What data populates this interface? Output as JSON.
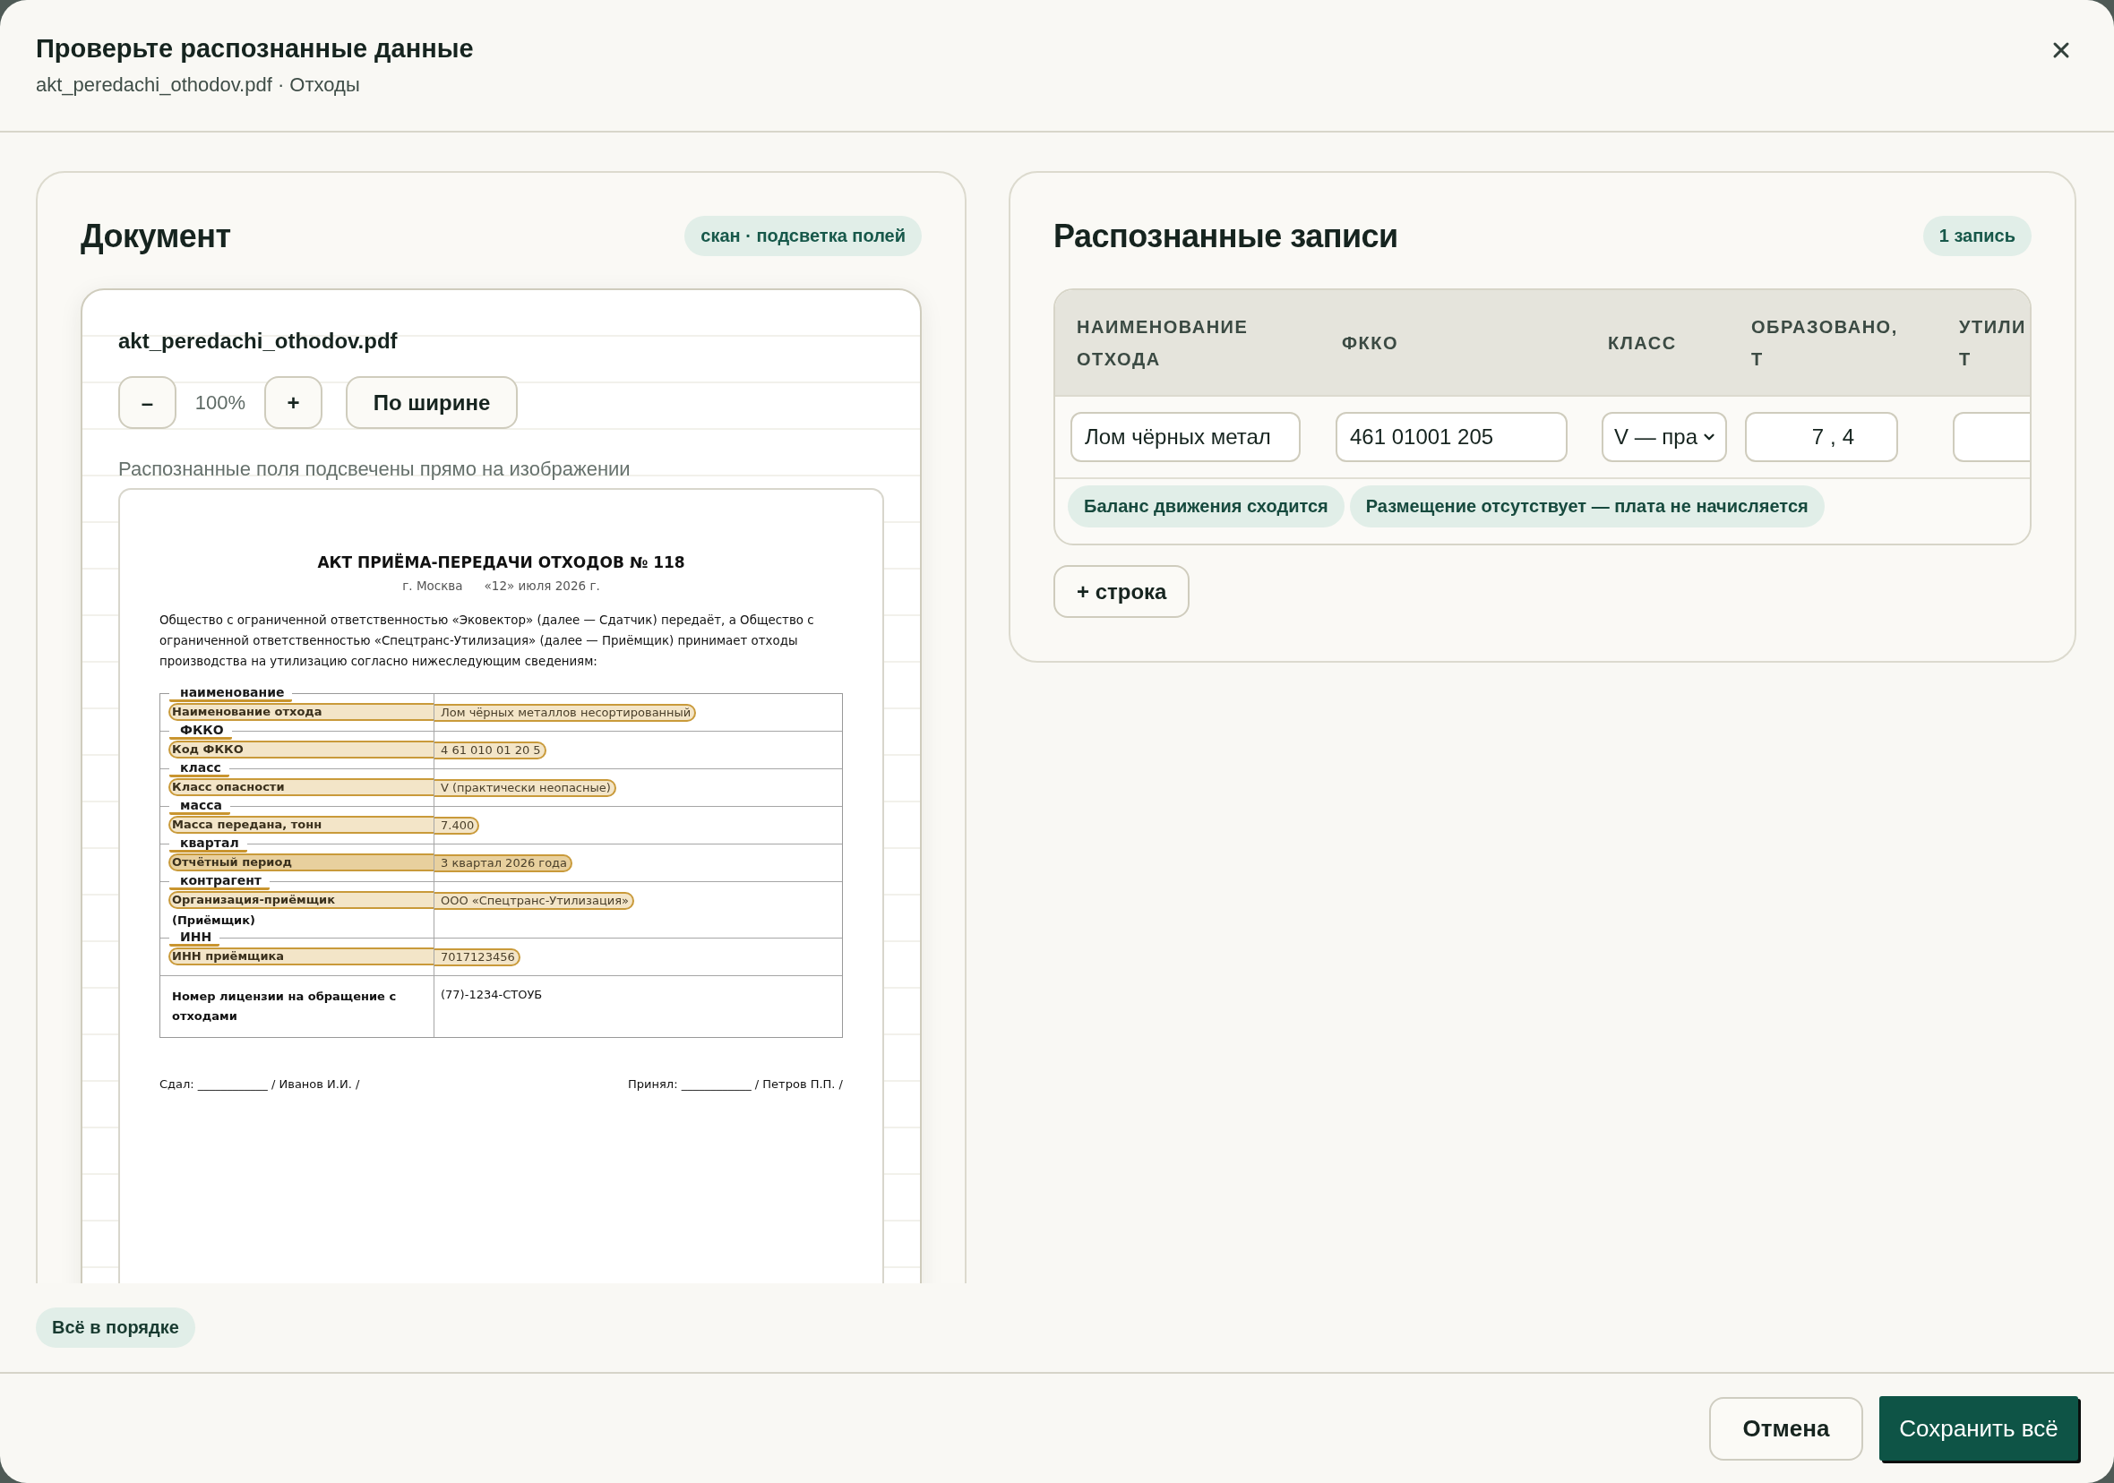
{
  "dialog": {
    "title": "Проверьте распознанные данные",
    "subtitle": "akt_peredachi_othodov.pdf · Отходы"
  },
  "document_panel": {
    "title": "Документ",
    "badge": "скан · подсветка полей",
    "viewer": {
      "file_name": "akt_peredachi_othodov.pdf",
      "zoom_out": "–",
      "zoom_level": "100%",
      "zoom_in": "+",
      "fit_width": "По ширине",
      "hint": "Распознанные поля подсвечены прямо на изображении",
      "page": {
        "title": "АКТ ПРИЁМА-ПЕРЕДАЧИ ОТХОДОВ № 118",
        "city": "г. Москва",
        "date": "«12» июля 2026 г.",
        "intro": "Общество с ограниченной ответственностью «Эковектор» (далее — Сдатчик) передаёт, а Общество с ограниченной ответственностью «Спецтранс-Утилизация» (далее — Приёмщик) принимает отходы производства на утилизацию согласно нижеследующим сведениям:",
        "rows": [
          {
            "tag": "наименование",
            "label": "Наименование отхода",
            "value": "Лом чёрных металлов несортированный",
            "highlighted": true,
            "selected": false
          },
          {
            "tag": "ФККО",
            "label": "Код ФККО",
            "value": "4 61 010 01 20 5",
            "highlighted": true,
            "selected": false
          },
          {
            "tag": "класс",
            "label": "Класс опасности",
            "value": "V (практически неопасные)",
            "highlighted": true,
            "selected": false
          },
          {
            "tag": "масса",
            "label": "Масса передана, тонн",
            "value": "7.400",
            "highlighted": true,
            "selected": false
          },
          {
            "tag": "квартал",
            "label": "Отчётный период",
            "value": "3 квартал 2026 года",
            "highlighted": true,
            "selected": true
          },
          {
            "tag": "контрагент",
            "label": "Организация-приёмщик",
            "label_note": "(Приёмщик)",
            "value": "ООО «Спецтранс-Утилизация»",
            "highlighted": true,
            "selected": false
          },
          {
            "tag": "ИНН",
            "label": "ИНН приёмщика",
            "value": "7017123456",
            "highlighted": true,
            "selected": false
          },
          {
            "label": "Номер лицензии на обращение с отходами",
            "value": "(77)-1234-СТОУБ",
            "highlighted": false,
            "selected": false
          }
        ],
        "signatures": [
          "Сдал: ____________ / Иванов И.И. /",
          "Принял: ____________ / Петров П.П. /"
        ]
      }
    }
  },
  "records_panel": {
    "title": "Распознанные записи",
    "count_badge": "1 запись",
    "columns": [
      "НАИМЕНОВАНИЕ ОТХОДА",
      "ФККО",
      "КЛАСС",
      "ОБРАЗОВАНО, Т",
      "УТИЛИ Т"
    ],
    "rows": [
      {
        "cells": [
          {
            "kind": "text",
            "value": "Лом чёрных метал"
          },
          {
            "kind": "text",
            "value": "461 01001 205"
          },
          {
            "kind": "select",
            "value": "V — пра"
          },
          {
            "kind": "number",
            "value": "7,4"
          },
          {
            "kind": "text"
          }
        ],
        "checks": [
          "Баланс движения сходится",
          "Размещение отсутствует — плата не начисляется"
        ]
      }
    ],
    "add_row_button": "+ строка"
  },
  "status_badge": "Всё в порядке",
  "footer_buttons": [
    {
      "label": "Отмена",
      "kind": "secondary"
    },
    {
      "label": "Сохранить всё",
      "kind": "primary"
    }
  ]
}
